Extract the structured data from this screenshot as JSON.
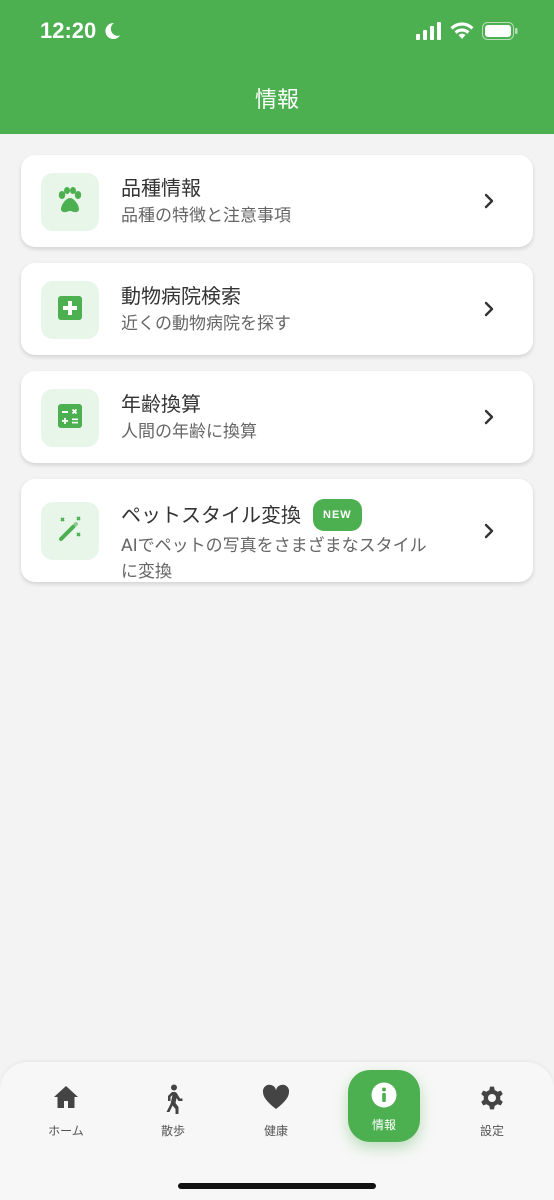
{
  "status_bar": {
    "time": "12:20"
  },
  "header": {
    "title": "情報"
  },
  "cards": [
    {
      "title": "品種情報",
      "subtitle": "品種の特徴と注意事項",
      "icon": "paw-icon"
    },
    {
      "title": "動物病院検索",
      "subtitle": "近くの動物病院を探す",
      "icon": "medical-cross-icon"
    },
    {
      "title": "年齢換算",
      "subtitle": "人間の年齢に換算",
      "icon": "calculator-icon"
    },
    {
      "title": "ペットスタイル変換",
      "badge": "NEW",
      "subtitle_line1": "AIでペットの写真をさまざまなスタイル",
      "subtitle_line2": "に変換",
      "icon": "magic-wand-icon"
    }
  ],
  "tabs": [
    {
      "label": "ホーム",
      "icon": "home-icon"
    },
    {
      "label": "散歩",
      "icon": "walk-icon"
    },
    {
      "label": "健康",
      "icon": "heart-icon"
    },
    {
      "label": "情報",
      "icon": "info-icon",
      "active": true
    },
    {
      "label": "設定",
      "icon": "gear-icon"
    }
  ],
  "colors": {
    "primary": "#4caf50",
    "icon_bg": "#e8f5e9",
    "background": "#f3f3f3"
  }
}
